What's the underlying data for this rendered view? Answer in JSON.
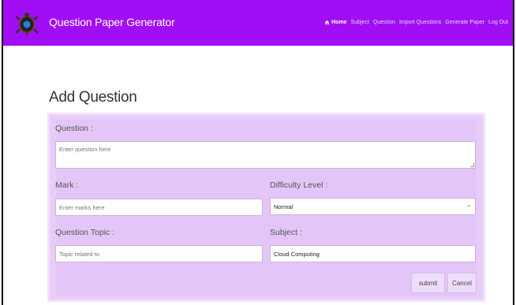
{
  "header": {
    "brand": "Question Paper Generator",
    "logo_icon": "tortoise-logo-icon",
    "nav": [
      {
        "label": "Home",
        "icon": "home-icon",
        "active": true
      },
      {
        "label": "Subject"
      },
      {
        "label": "Question"
      },
      {
        "label": "Import Questions"
      },
      {
        "label": "Generate Paper"
      },
      {
        "label": "Log Out"
      }
    ],
    "color": "#a10ef6"
  },
  "page_title": "Add Question",
  "form": {
    "question_label": "Question :",
    "question_placeholder": "Enter question here",
    "mark_label": "Mark :",
    "mark_placeholder": "Enter marks here",
    "difficulty_label": "Difficulty Level :",
    "difficulty_value": "Normal",
    "topic_label": "Question Topic :",
    "topic_placeholder": "Topic related to",
    "subject_label": "Subject :",
    "subject_value": "Cloud Computing",
    "submit_label": "submit",
    "cancel_label": "Cancel"
  }
}
